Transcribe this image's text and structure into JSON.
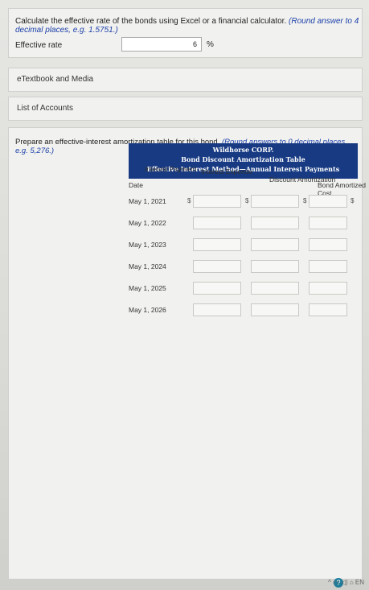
{
  "question1": {
    "text": "Calculate the effective rate of the bonds using Excel or a financial calculator.",
    "instruction": "(Round answer to 4 decimal places, e.g. 1.5751.)",
    "label": "Effective rate",
    "value": "6",
    "unit": "%"
  },
  "links": {
    "etextbook": "eTextbook and Media",
    "accounts": "List of Accounts"
  },
  "question2": {
    "text": "Prepare an effective-interest amortization table for this bond.",
    "instruction": "(Round answers to 0 decimal places, e.g. 5,276.)"
  },
  "table": {
    "title1": "Wildhorse CORP.",
    "title2": "Bond Discount Amortization Table",
    "title3": "Effective Interest Method—Annual Interest Payments",
    "headers": {
      "date": "Date",
      "interest_payment": "Interest Payment",
      "interest_expense": "Interest Expense",
      "discount_amortization": "Discount Amortization",
      "bond_amortized_cost": "Bond Amortized Cost"
    },
    "dates": [
      "May 1, 2021",
      "May 1, 2022",
      "May 1, 2023",
      "May 1, 2024",
      "May 1, 2025",
      "May 1, 2026"
    ],
    "currency": "$"
  },
  "taskbar": {
    "help": "?",
    "tray": "^ ▭ ◁) ⌂ EN"
  }
}
